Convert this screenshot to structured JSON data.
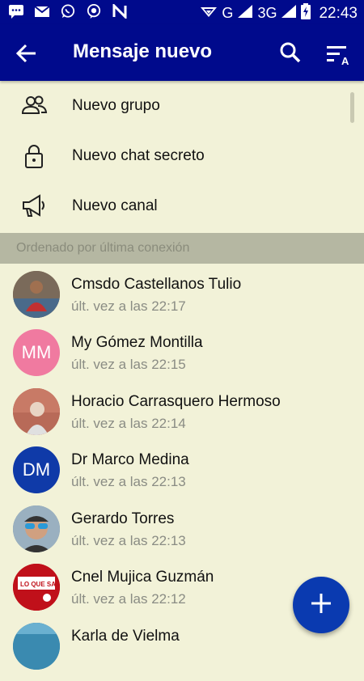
{
  "status_bar": {
    "time": "22:43",
    "network_label": "G",
    "network_label_2": "3G",
    "notification_icons": [
      "sms-icon",
      "gmail-icon",
      "whatsapp-icon",
      "messenger-icon",
      "n-app-icon"
    ]
  },
  "header": {
    "title": "Mensaje nuevo",
    "back_icon": "arrow-left-icon",
    "search_icon": "search-icon",
    "sort_icon": "sort-az-icon"
  },
  "menu": [
    {
      "label": "Nuevo grupo",
      "icon": "group-icon"
    },
    {
      "label": "Nuevo chat secreto",
      "icon": "lock-icon"
    },
    {
      "label": "Nuevo canal",
      "icon": "megaphone-icon"
    }
  ],
  "section_header": "Ordenado por última conexión",
  "contacts": [
    {
      "name": "Cmsdo Castellanos Tulio",
      "status": "últ. vez a las 22:17",
      "initials": "",
      "avatar_color": "#8a6a4a"
    },
    {
      "name": "My Gómez Montilla",
      "status": "últ. vez a las 22:15",
      "initials": "MM",
      "avatar_color": "#f07aa0"
    },
    {
      "name": "Horacio Carrasquero Hermoso",
      "status": "últ. vez a las 22:14",
      "initials": "",
      "avatar_color": "#c96a55"
    },
    {
      "name": "Dr Marco Medina",
      "status": "últ. vez a las 22:13",
      "initials": "DM",
      "avatar_color": "#0f3aa8"
    },
    {
      "name": "Gerardo Torres",
      "status": "últ. vez a las 22:13",
      "initials": "",
      "avatar_color": "#6f8aa0"
    },
    {
      "name": "Cnel Mujica Guzmán",
      "status": "últ. vez a las 22:12",
      "initials": "",
      "avatar_color": "#c0101a",
      "avatar_text": "LO QUE SABE"
    },
    {
      "name": "Karla de Vielma",
      "status": "",
      "initials": "",
      "avatar_color": "#3a8ab0"
    }
  ],
  "fab_icon": "plus-icon",
  "colors": {
    "primary": "#000a8c",
    "background": "#f2f2d8",
    "section": "#b5b7a2",
    "fab": "#0a3ab0"
  }
}
